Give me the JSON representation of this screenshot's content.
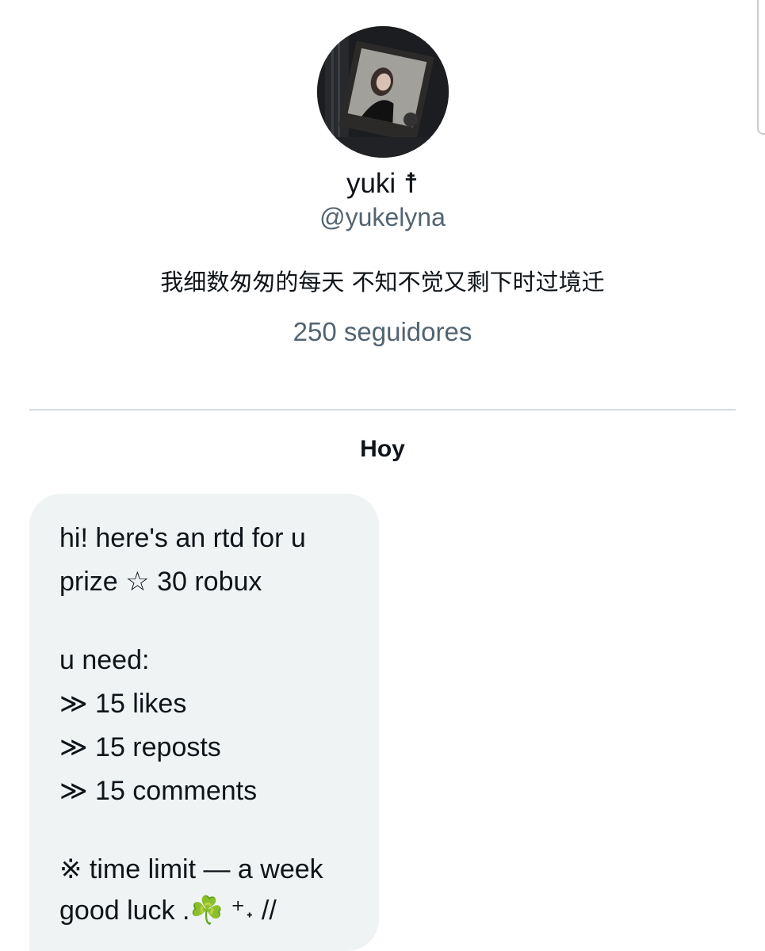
{
  "profile": {
    "display_name": "yuki ☨",
    "handle": "@yukelyna",
    "bio": "我细数匆匆的每天 不知不觉又剩下时过境迁",
    "followers": "250 seguidores"
  },
  "conversation": {
    "date_label": "Hoy",
    "message_lines": [
      "hi! here's an rtd for u",
      "prize ☆ 30 robux",
      "u need:",
      "≫ 15 likes",
      "≫ 15 reposts",
      "≫ 15 comments",
      "※ time limit — a week",
      "good luck .☘️ ⁺˖ //"
    ]
  },
  "icons": {
    "avatar": "profile-photo-avatar"
  }
}
